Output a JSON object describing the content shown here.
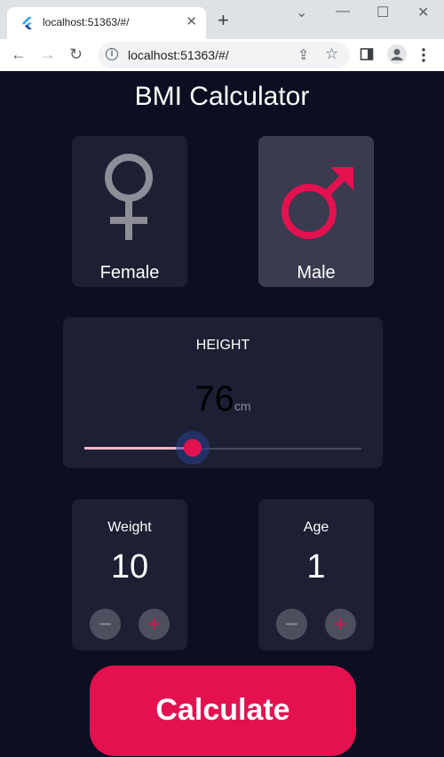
{
  "browser": {
    "tab_title": "localhost:51363/#/",
    "tab_close": "✕",
    "new_tab": "+",
    "url": "localhost:51363/#/",
    "info_icon": "i",
    "controls": {
      "chevron": "⌄",
      "minimize": "—",
      "maximize": "☐",
      "close": "✕"
    },
    "nav": {
      "back": "←",
      "forward": "→",
      "reload": "↻"
    }
  },
  "app": {
    "title": "BMI Calculator",
    "gender": {
      "female": {
        "label": "Female",
        "icon": "female-symbol-icon",
        "selected": false
      },
      "male": {
        "label": "Male",
        "icon": "male-symbol-icon",
        "selected": true
      }
    },
    "height": {
      "label": "HEIGHT",
      "value": "76",
      "unit": "cm",
      "slider_fraction": 0.38
    },
    "weight": {
      "label": "Weight",
      "value": "10"
    },
    "age": {
      "label": "Age",
      "value": "1"
    },
    "buttons": {
      "minus": "−",
      "plus": "+",
      "calculate": "Calculate"
    }
  },
  "colors": {
    "background": "#0b0f21",
    "card": "#1d1f33",
    "card_active": "#3a3b4f",
    "accent": "#e41151",
    "inactive_icon": "#8d8e98"
  }
}
